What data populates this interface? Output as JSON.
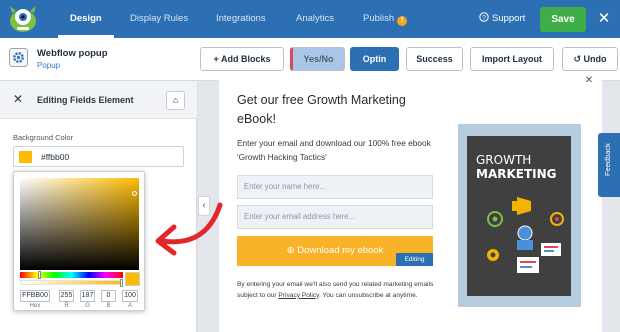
{
  "topbar": {
    "tabs": [
      "Design",
      "Display Rules",
      "Integrations",
      "Analytics",
      "Publish"
    ],
    "support_label": "Support",
    "save_label": "Save",
    "colors": {
      "bar": "#2d6fb3",
      "save": "#3fae49",
      "badge": "#f5a623"
    }
  },
  "campaign": {
    "name": "Webflow popup",
    "type": "Popup"
  },
  "toolbar": {
    "add_blocks": "+ Add Blocks",
    "yesno": "Yes/No",
    "optin": "Optin",
    "success": "Success",
    "import_layout": "Import Layout",
    "undo": "Undo"
  },
  "panel": {
    "title": "Editing Fields Element",
    "bg_label": "Background Color",
    "bg_value": "#ffbb00",
    "picker": {
      "hex": "FFBB00",
      "r": "255",
      "g": "187",
      "b": "0",
      "a": "100",
      "labels": {
        "hex": "Hex",
        "r": "R",
        "g": "G",
        "b": "B",
        "a": "A"
      },
      "color": "#ffbb00"
    }
  },
  "popup": {
    "headline": "Get our free Growth Marketing eBook!",
    "subtext": "Enter your email and download our 100% free ebook 'Growth Hacking Tactics'",
    "name_placeholder": "Enter your name here...",
    "email_placeholder": "Enter your email address here...",
    "button_label": "Download my ebook",
    "editing_tag": "Editing",
    "disclaimer_pre": "By entering your email we'll also send you related marketing emails subject to our ",
    "disclaimer_link": "Privacy Policy",
    "disclaimer_post": ". You can unsubscribe at anytime.",
    "book_line1": "GROWTH",
    "book_line2": "MARKETING",
    "button_color": "#f8b329"
  },
  "feedback_label": "Feedback"
}
